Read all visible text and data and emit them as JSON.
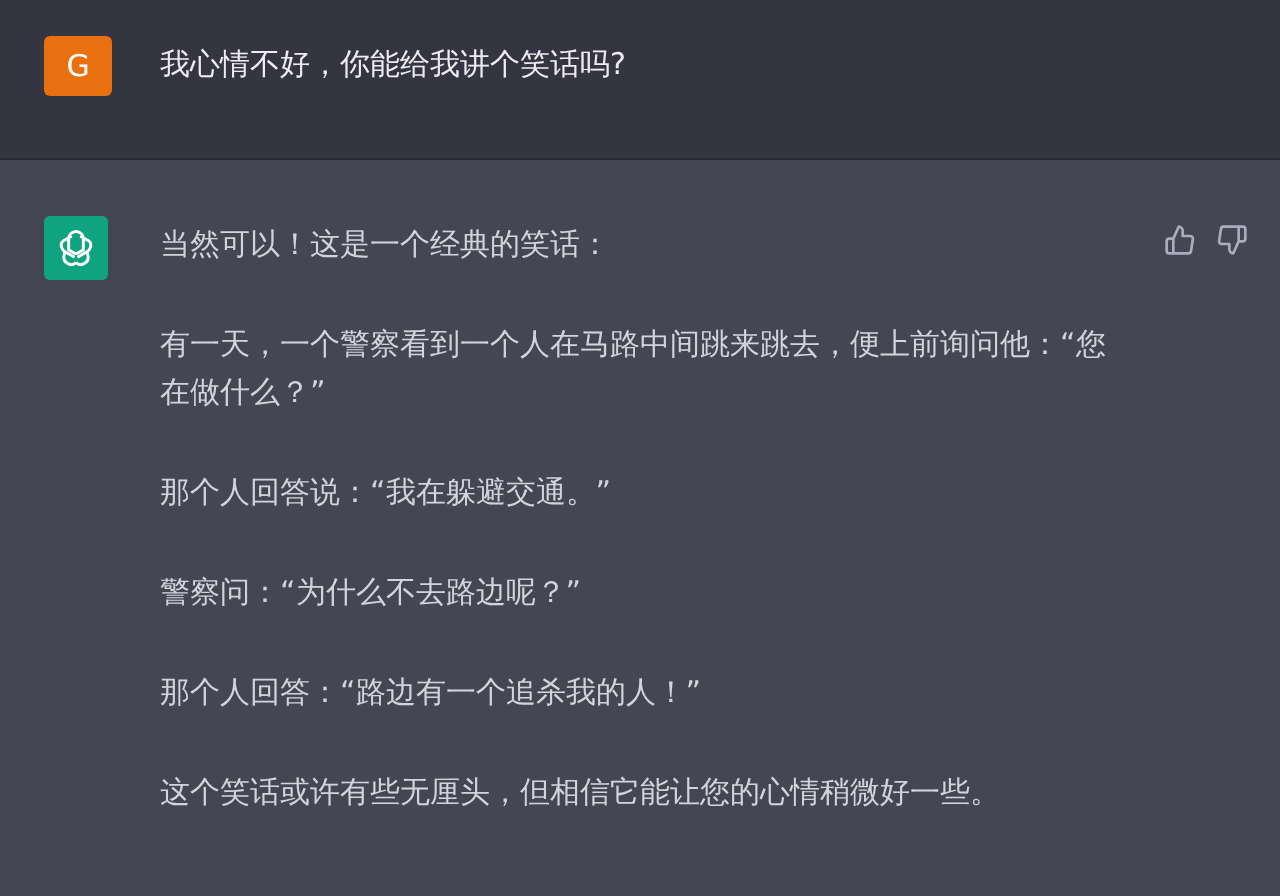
{
  "messages": [
    {
      "kind": "user",
      "avatar": "G",
      "paragraphs": [
        "我心情不好，你能给我讲个笑话吗?"
      ]
    },
    {
      "kind": "assistant",
      "paragraphs": [
        "当然可以！这是一个经典的笑话：",
        "有一天，一个警察看到一个人在马路中间跳来跳去，便上前询问他：“您在做什么？”",
        "那个人回答说：“我在躲避交通。”",
        "警察问：“为什么不去路边呢？”",
        "那个人回答：“路边有一个追杀我的人！”",
        "这个笑话或许有些无厘头，但相信它能让您的心情稍微好一些。"
      ]
    }
  ]
}
